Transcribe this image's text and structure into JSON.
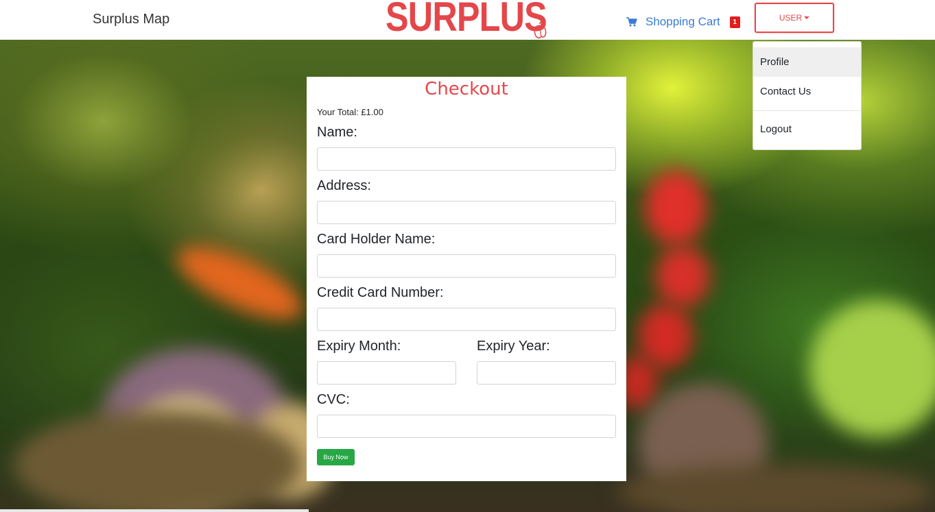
{
  "header": {
    "brand_link": "Surplus Map",
    "logo_text": "SURPLUS",
    "cart": {
      "label": "Shopping Cart",
      "count": "1",
      "icon": "shopping-cart-icon"
    },
    "user_button": "USER"
  },
  "dropdown": {
    "items": [
      {
        "label": "Profile"
      },
      {
        "label": "Contact Us"
      },
      {
        "label": "Logout"
      }
    ]
  },
  "checkout": {
    "title": "Checkout",
    "total": "Your Total: £1.00",
    "fields": {
      "name": {
        "label": "Name:",
        "value": ""
      },
      "address": {
        "label": "Address:",
        "value": ""
      },
      "card_holder": {
        "label": "Card Holder Name:",
        "value": ""
      },
      "card_number": {
        "label": "Credit Card Number:",
        "value": ""
      },
      "expiry_month": {
        "label": "Expiry Month:",
        "value": ""
      },
      "expiry_year": {
        "label": "Expiry Year:",
        "value": ""
      },
      "cvc": {
        "label": "CVC:",
        "value": ""
      }
    },
    "submit": "Buy Now"
  },
  "colors": {
    "brand": "#e4474a",
    "link": "#3a7bd5",
    "badge": "#e11d1d",
    "buy_button": "#28a745"
  }
}
